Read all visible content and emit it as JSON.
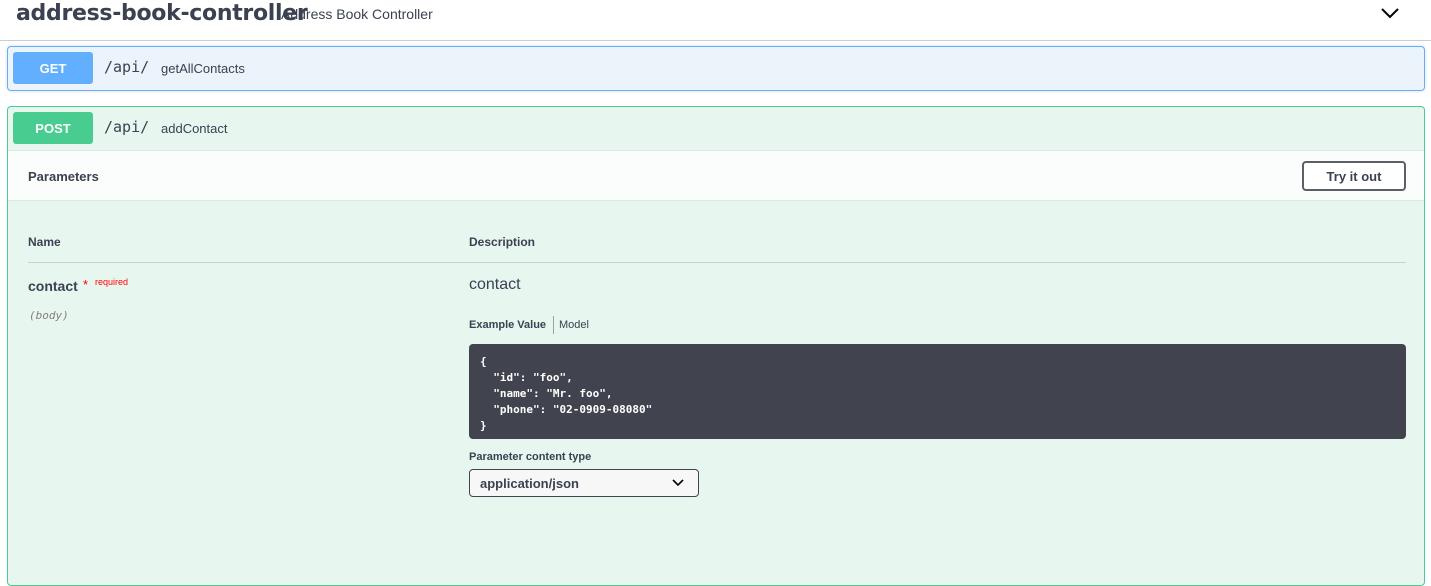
{
  "tag": {
    "title": "address-book-controller",
    "description": "Address Book Controller"
  },
  "operations": [
    {
      "method": "GET",
      "path": "/api/",
      "summary": "getAllContacts"
    },
    {
      "method": "POST",
      "path": "/api/",
      "summary": "addContact"
    }
  ],
  "parameters": {
    "section_title": "Parameters",
    "try_button": "Try it out",
    "col_name": "Name",
    "col_description": "Description",
    "param": {
      "name": "contact",
      "required_star": "*",
      "required_text": "required",
      "location": "(body)",
      "description": "contact"
    },
    "tabs": {
      "example": "Example Value",
      "model": "Model"
    },
    "example_json": "{\n  \"id\": \"foo\",\n  \"name\": \"Mr. foo\",\n  \"phone\": \"02-0909-08080\"\n}",
    "content_type_label": "Parameter content type",
    "content_type_value": "application/json"
  },
  "icons": {
    "collapse": "chevron-down-icon",
    "select": "chevron-down-icon"
  },
  "colors": {
    "get": "#61affe",
    "post": "#49cc90",
    "code_bg": "#41444e",
    "required": "#ff0000"
  }
}
